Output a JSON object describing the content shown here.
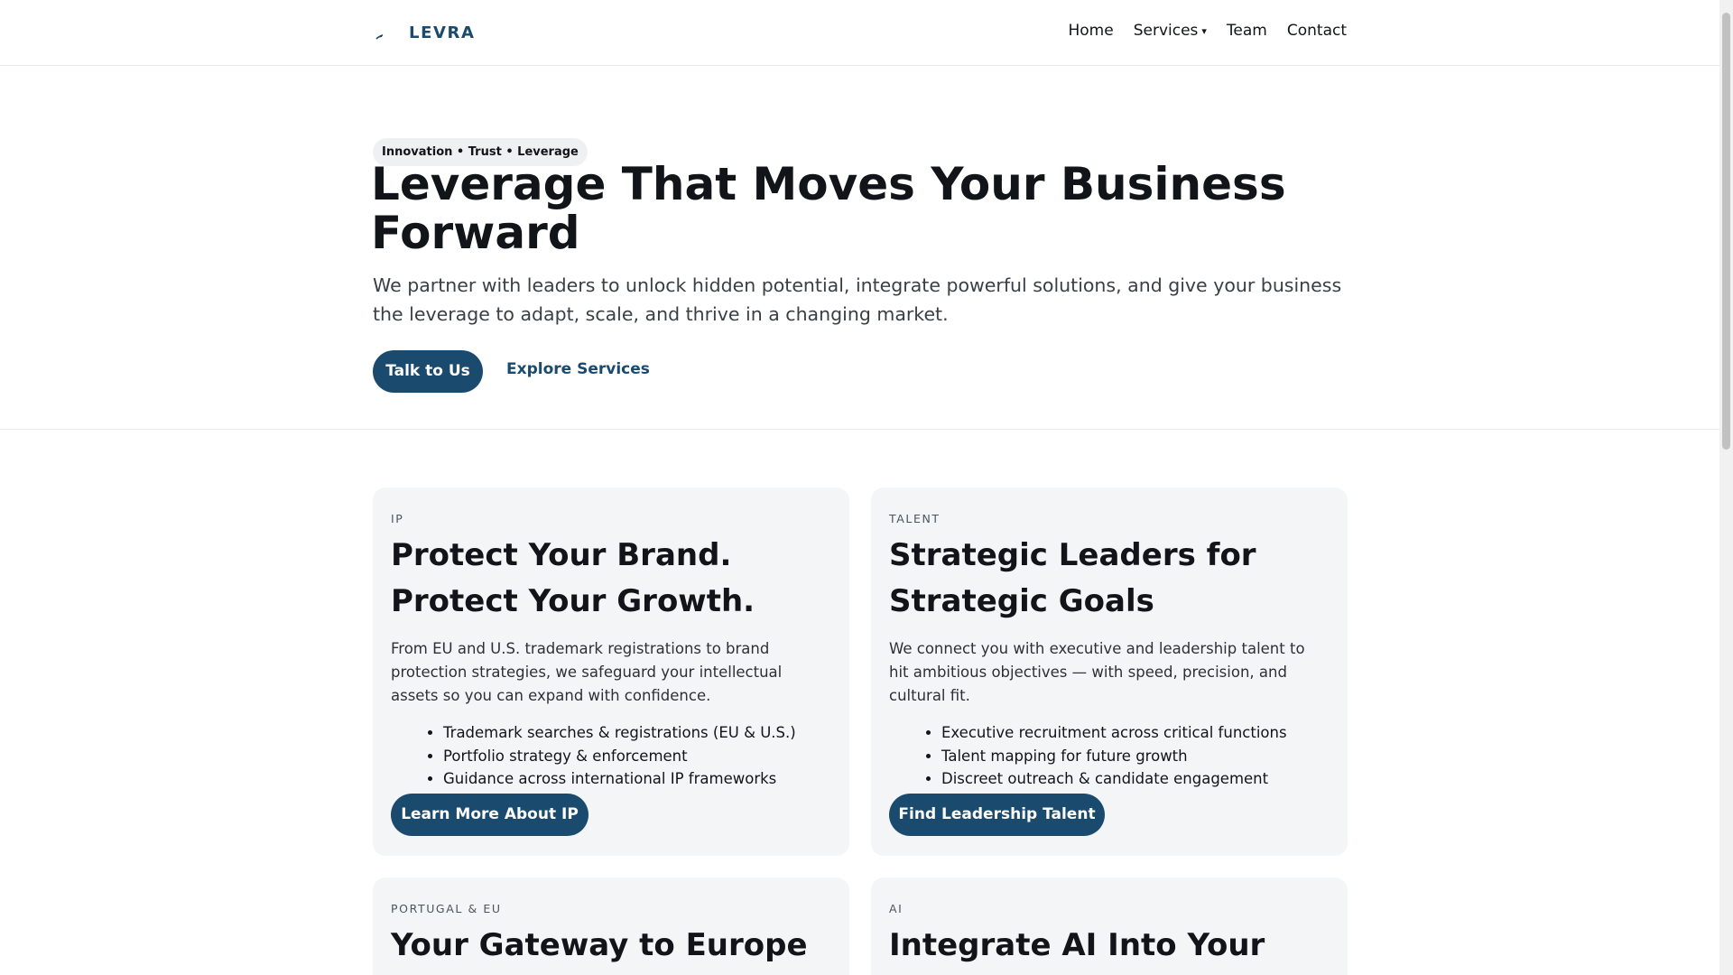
{
  "header": {
    "brand": "LEVRA",
    "nav": [
      {
        "label": "Home"
      },
      {
        "label": "Services",
        "caret": "▾"
      },
      {
        "label": "Team"
      },
      {
        "label": "Contact"
      }
    ]
  },
  "hero": {
    "pill": "Innovation • Trust • Leverage",
    "title": "Leverage That Moves Your Business Forward",
    "subtitle": "We partner with leaders to unlock hidden potential, integrate powerful solutions, and give your business the leverage to adapt, scale, and thrive in a changing market.",
    "primary_cta": "Talk to Us",
    "secondary_cta": "Explore Services"
  },
  "cards": [
    {
      "tag": "IP",
      "title": "Protect Your Brand. Protect Your Growth.",
      "description": "From EU and U.S. trademark registrations to brand protection strategies, we safeguard your intellectual assets so you can expand with confidence.",
      "bullets": [
        "Trademark searches & registrations (EU & U.S.)",
        "Portfolio strategy & enforcement",
        "Guidance across international IP frameworks"
      ],
      "cta": "Learn More About IP"
    },
    {
      "tag": "TALENT",
      "title": "Strategic Leaders for Strategic Goals",
      "description": "We connect you with executive and leadership talent to hit ambitious objectives — with speed, precision, and cultural fit.",
      "bullets": [
        "Executive recruitment across critical functions",
        "Talent mapping for future growth",
        "Discreet outreach & candidate engagement"
      ],
      "cta": "Find Leadership Talent"
    },
    {
      "tag": "PORTUGAL & EU",
      "title": "Your Gateway to Europe"
    },
    {
      "tag": "AI",
      "title": "Integrate AI Into Your Core"
    }
  ],
  "colors": {
    "accent": "#1a4a6e",
    "card_bg": "#f4f5f6",
    "pill_bg": "#eef0f2"
  }
}
